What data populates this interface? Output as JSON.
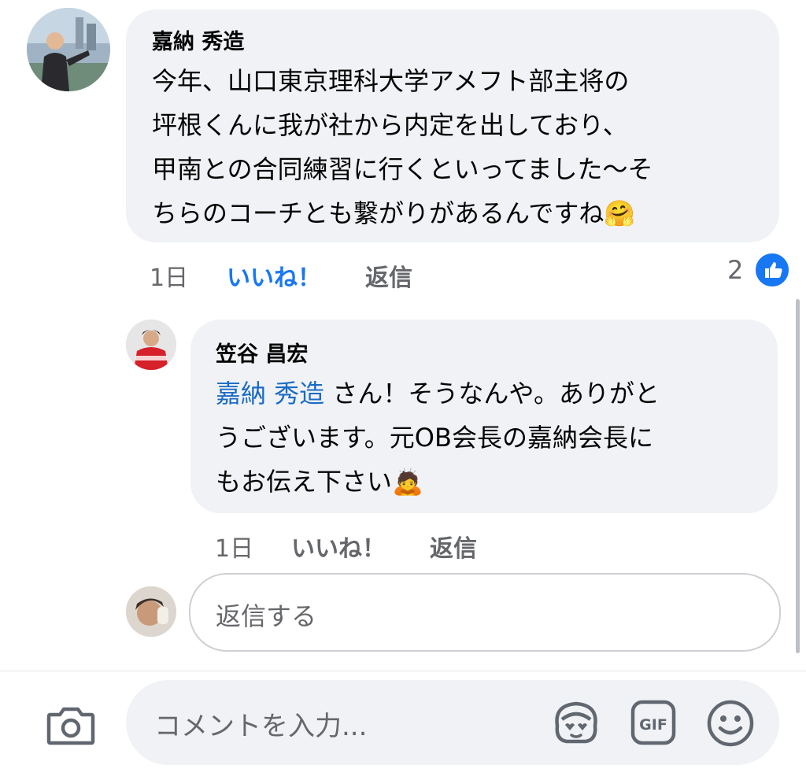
{
  "comment1": {
    "author": "嘉納 秀造",
    "text": "今年、山口東京理科大学アメフト部主将の\n坪根くんに我が社から内定を出しており、\n甲南との合同練習に行くといってました〜そ\nちらのコーチとも繋がりがあるんですね🤗",
    "time": "1日",
    "like_label": "いいね！",
    "reply_label": "返信",
    "reaction_count": "2",
    "reaction_icon": "like-thumb-icon"
  },
  "reply1": {
    "author": "笠谷 昌宏",
    "mention": "嘉納 秀造",
    "text": " さん！そうなんや。ありがと\nうございます。元OB会長の嘉納会長に\nもお伝え下さい🙇",
    "time": "1日",
    "like_label": "いいね！",
    "reply_label": "返信"
  },
  "reply_input": {
    "placeholder": "返信する"
  },
  "composer": {
    "placeholder": "コメントを入力...",
    "icons": [
      "camera-icon",
      "avatar-sticker-icon",
      "gif-icon",
      "emoji-icon"
    ],
    "gif_label": "GIF"
  },
  "colors": {
    "accent": "#1877f2",
    "mention": "#1a6bc4",
    "bubble": "#f0f2f5"
  }
}
